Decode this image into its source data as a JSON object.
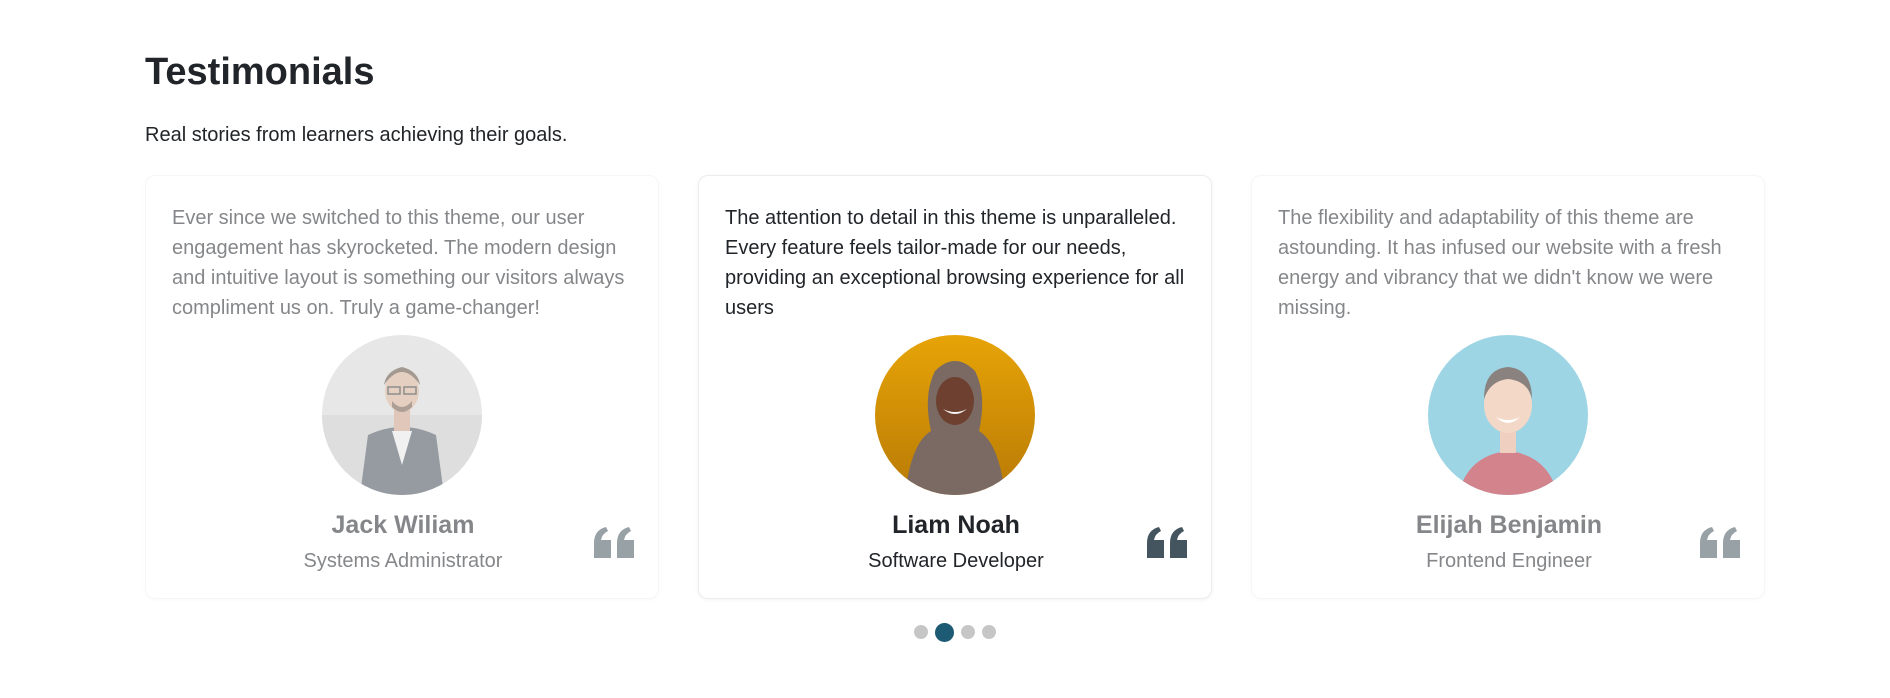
{
  "section": {
    "title": "Testimonials",
    "subtitle": "Real stories from learners achieving their goals."
  },
  "testimonials": [
    {
      "text": "Ever since we switched to this theme, our user engagement has skyrocketed. The modern design and intuitive layout is something our visitors always compliment us on. Truly a game-changer!",
      "name": "Jack Wiliam",
      "role": "Systems Administrator",
      "active": false
    },
    {
      "text": "The attention to detail in this theme is unparalleled. Every feature feels tailor-made for our needs, providing an exceptional browsing experience for all users",
      "name": "Liam Noah",
      "role": "Software Developer",
      "active": true
    },
    {
      "text": "The flexibility and adaptability of this theme are astounding. It has infused our website with a fresh energy and vibrancy that we didn't know we were missing.",
      "name": "Elijah Benjamin",
      "role": "Frontend Engineer",
      "active": false
    }
  ],
  "pagination": {
    "count": 4,
    "active_index": 1
  },
  "icons": {
    "quote": "quote-icon"
  },
  "colors": {
    "quote_icon": "#44555f",
    "dot_active": "#1d5a73",
    "dot_inactive": "#c6c6c6"
  }
}
